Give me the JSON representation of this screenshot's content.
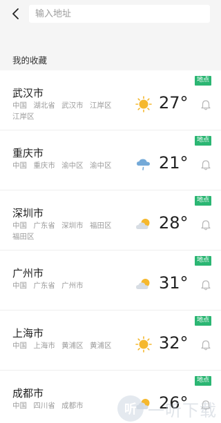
{
  "search": {
    "placeholder": "输入地址"
  },
  "favorites": {
    "section_title": "我的收藏",
    "items": [
      {
        "city": "武汉市",
        "admin": "中国 湖北省 武汉市 江岸区 江岸区",
        "weather_icon": "sunny",
        "temp": "27°",
        "badge": "地点"
      },
      {
        "city": "重庆市",
        "admin": "中国 重庆市 渝中区 渝中区",
        "weather_icon": "rain",
        "temp": "21°",
        "badge": "地点"
      },
      {
        "city": "深圳市",
        "admin": "中国 广东省 深圳市 福田区 福田区",
        "weather_icon": "partly-cloudy",
        "temp": "28°",
        "badge": "地点"
      },
      {
        "city": "广州市",
        "admin": "中国 广东省 广州市",
        "weather_icon": "partly-cloudy",
        "temp": "31°",
        "badge": "地点"
      },
      {
        "city": "上海市",
        "admin": "中国 上海市 黄浦区 黄浦区",
        "weather_icon": "sunny",
        "temp": "32°",
        "badge": "地点"
      },
      {
        "city": "成都市",
        "admin": "中国 四川省 成都市",
        "weather_icon": "partly-cloudy",
        "temp": "26°",
        "badge": "地点"
      }
    ]
  },
  "watermark": {
    "text": "一听下载"
  },
  "colors": {
    "badge": "#2bb673",
    "sun": "#f5b82e",
    "cloud": "#d7dde4",
    "rain": "#73a9d8"
  }
}
